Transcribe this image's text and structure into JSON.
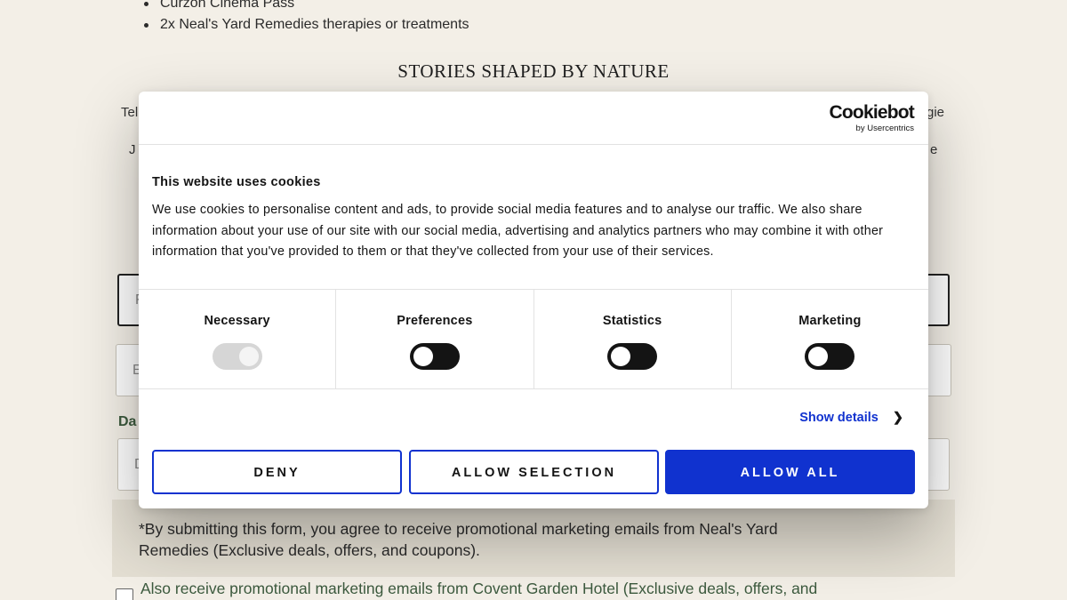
{
  "background": {
    "list_items": [
      "Curzon Cinema Pass",
      "2x Neal's Yard Remedies therapies or treatments"
    ],
    "section_title": "STORIES SHAPED BY NATURE",
    "frag_left_1": "Tel",
    "frag_left_2": "J",
    "frag_right_1": "gie",
    "frag_right_2": "e",
    "input_1_placeholder": "F",
    "input_2_placeholder": "E",
    "label_da": "Da",
    "input_3_placeholder": "D",
    "consent_text": "*By submitting this form, you agree to receive promotional marketing emails from Neal's Yard Remedies (Exclusive deals, offers, and coupons).",
    "also_text": "Also receive promotional marketing emails from Covent Garden Hotel (Exclusive deals, offers, and"
  },
  "dialog": {
    "logo_brand": "Cookiebot",
    "logo_sub": "by Usercentrics",
    "title": "This website uses cookies",
    "body": "We use cookies to personalise content and ads, to provide social media features and to analyse our traffic. We also share information about your use of our site with our social media, advertising and analytics partners who may combine it with other information that you've provided to them or that they've collected from your use of their services.",
    "toggles": [
      {
        "label": "Necessary",
        "state": "on-disabled"
      },
      {
        "label": "Preferences",
        "state": "off"
      },
      {
        "label": "Statistics",
        "state": "off"
      },
      {
        "label": "Marketing",
        "state": "off"
      }
    ],
    "show_details": "Show details",
    "chevron_icon": "chevron-right-icon",
    "buttons": {
      "deny": "DENY",
      "allow_selection": "ALLOW SELECTION",
      "allow_all": "ALLOW ALL"
    }
  },
  "colors": {
    "accent": "#1032cf",
    "page_bg": "#f3efe7",
    "consent_bg": "#e4dfd3",
    "green_text": "#3c5a3e"
  }
}
